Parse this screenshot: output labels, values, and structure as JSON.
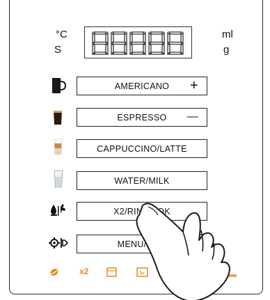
{
  "display": {
    "unit_top_left": "°C",
    "unit_bottom_left": "S",
    "unit_top_right": "ml",
    "unit_bottom_right": "g",
    "digits": "88888"
  },
  "buttons": [
    {
      "label": "AMERICANO",
      "symbol": "+",
      "icon": "americano-cup-icon"
    },
    {
      "label": "ESPRESSO",
      "symbol": "—",
      "icon": "espresso-cup-icon"
    },
    {
      "label": "CAPPUCCINO/LATTE",
      "symbol": "",
      "icon": "latte-glass-icon"
    },
    {
      "label": "WATER/MILK",
      "symbol": "",
      "icon": "water-glass-icon"
    },
    {
      "label": "X2/RINSE/OK",
      "symbol": "",
      "icon": "rinse-icon"
    },
    {
      "label": "MENU/EXIT",
      "symbol": "",
      "icon": "menu-exit-icon"
    }
  ],
  "status_bar": {
    "x2_label": "x2",
    "accent_color": "#e88a1a",
    "icons": [
      "coffee-bean-icon",
      "x2-indicator",
      "tray-icon",
      "container-icon",
      "descale-icon",
      "drip-tray-icon"
    ]
  }
}
